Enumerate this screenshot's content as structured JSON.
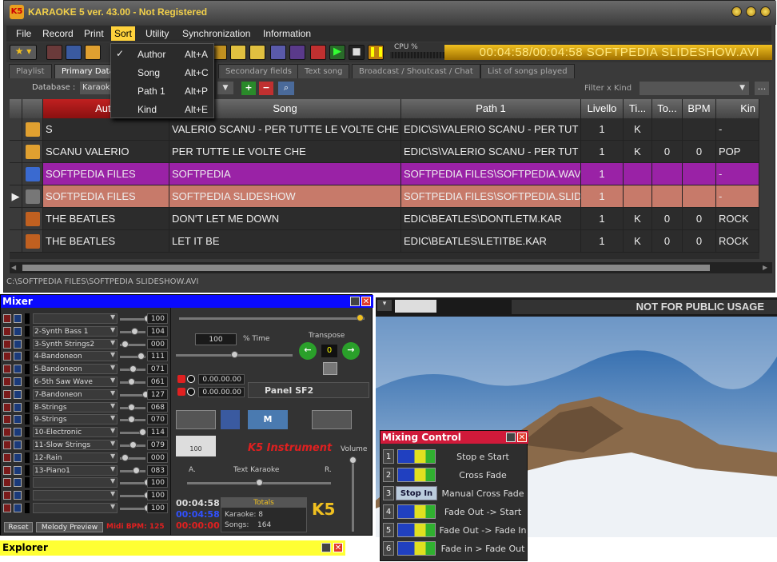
{
  "app": {
    "title": "KARAOKE 5   ver. 43.00 - Not Registered"
  },
  "menubar": {
    "items": [
      {
        "label": "File"
      },
      {
        "label": "Record"
      },
      {
        "label": "Print"
      },
      {
        "label": "Sort"
      },
      {
        "label": "Utility"
      },
      {
        "label": "Synchronization"
      },
      {
        "label": "Information"
      }
    ]
  },
  "sort_menu": {
    "items": [
      {
        "label": "Author",
        "shortcut": "Alt+A",
        "checked": true
      },
      {
        "label": "Song",
        "shortcut": "Alt+C"
      },
      {
        "label": "Path 1",
        "shortcut": "Alt+P"
      },
      {
        "label": "Kind",
        "shortcut": "Alt+E"
      }
    ]
  },
  "toolbar": {
    "cpu_label": "CPU %",
    "now_playing": "00:04:58/00:04:58  SOFTPEDIA SLIDESHOW.AVI"
  },
  "tabs": [
    {
      "label": "Playlist"
    },
    {
      "label": "Primary Data"
    },
    {
      "label": "Secondary fields"
    },
    {
      "label": "Text song"
    },
    {
      "label": "Broadcast / Shoutcast / Chat"
    },
    {
      "label": "List of songs played"
    }
  ],
  "database": {
    "label": "Database :",
    "value": "Karaok",
    "filter_label": "Filter x Kind"
  },
  "grid": {
    "columns": [
      {
        "label": ""
      },
      {
        "label": "Auth"
      },
      {
        "label": "Song"
      },
      {
        "label": "Path 1"
      },
      {
        "label": "Livello"
      },
      {
        "label": "Ti..."
      },
      {
        "label": "To..."
      },
      {
        "label": "BPM"
      },
      {
        "label": "Kin"
      }
    ],
    "rows": [
      {
        "author": "S",
        "song": "VALERIO SCANU - PER TUTTE LE VOLTE CHE",
        "path": "EDIC\\S\\VALERIO SCANU - PER TUT",
        "livello": "1",
        "ti": "K",
        "to": "",
        "bpm": "",
        "kind": "-",
        "icon": "karaoke-icon",
        "style": "normal"
      },
      {
        "author": "SCANU VALERIO",
        "song": "PER TUTTE LE VOLTE CHE",
        "path": "EDIC\\S\\VALERIO SCANU - PER TUT",
        "livello": "1",
        "ti": "K",
        "to": "0",
        "bpm": "0",
        "kind": "POP",
        "icon": "karaoke-icon",
        "style": "normal"
      },
      {
        "author": "SOFTPEDIA FILES",
        "song": "SOFTPEDIA",
        "path": "SOFTPEDIA FILES\\SOFTPEDIA.WAV",
        "livello": "1",
        "ti": "",
        "to": "",
        "bpm": "",
        "kind": "-",
        "icon": "music-note-icon",
        "style": "purple"
      },
      {
        "author": "SOFTPEDIA FILES",
        "song": "SOFTPEDIA SLIDESHOW",
        "path": "SOFTPEDIA FILES\\SOFTPEDIA.SLIDE",
        "livello": "1",
        "ti": "",
        "to": "",
        "bpm": "",
        "kind": "-",
        "icon": "film-reel-icon",
        "style": "salmon"
      },
      {
        "author": "THE BEATLES",
        "song": "DON'T LET ME DOWN",
        "path": "EDIC\\BEATLES\\DONTLETM.KAR",
        "livello": "1",
        "ti": "K",
        "to": "0",
        "bpm": "0",
        "kind": "ROCK",
        "icon": "kar-file-icon",
        "style": "normal"
      },
      {
        "author": "THE BEATLES",
        "song": "LET IT BE",
        "path": "EDIC\\BEATLES\\LETITBE.KAR",
        "livello": "1",
        "ti": "K",
        "to": "0",
        "bpm": "0",
        "kind": "ROCK",
        "icon": "kar-file-icon",
        "style": "normal"
      }
    ]
  },
  "status": {
    "path": "C:\\SOFTPEDIA FILES\\SOFTPEDIA SLIDESHOW.AVI"
  },
  "mixer": {
    "title": "Mixer",
    "channels": [
      {
        "name": "",
        "value": "100"
      },
      {
        "name": "2-Synth Bass 1",
        "value": "104"
      },
      {
        "name": "3-Synth Strings2",
        "value": "000"
      },
      {
        "name": "4-Bandoneon",
        "value": "111"
      },
      {
        "name": "5-Bandoneon",
        "value": "071"
      },
      {
        "name": "6-5th Saw Wave",
        "value": "061"
      },
      {
        "name": "7-Bandoneon",
        "value": "127"
      },
      {
        "name": "8-Strings",
        "value": "068"
      },
      {
        "name": "9-Strings",
        "value": "070"
      },
      {
        "name": "10-Electronic",
        "value": "114"
      },
      {
        "name": "11-Slow Strings",
        "value": "079"
      },
      {
        "name": "12-Rain",
        "value": "000"
      },
      {
        "name": "13-Piano1",
        "value": "083"
      },
      {
        "name": "",
        "value": "100"
      },
      {
        "name": "",
        "value": "100"
      },
      {
        "name": "",
        "value": "100"
      }
    ],
    "reset_label": "Reset",
    "preview_label": "Melody Preview",
    "midi_bpm": "Midi BPM: 125",
    "tempo_value": "100",
    "time_label": "% Time",
    "transpose_label": "Transpose",
    "transpose_value": "0",
    "time1": "0.00.00.00",
    "time2": "0.00.00.00",
    "panel_label": "Panel SF2",
    "instrument_label": "K5 Instrument",
    "volume_label": "Volume",
    "text_karaoke_label": "Text Karaoke",
    "a_label": "A.",
    "r_label": "R.",
    "dial_value": "100",
    "clock1": "00:04:58",
    "clock2": "00:04:58",
    "clock3": "00:00:00",
    "totals_label": "Totals",
    "karaoke_count": "Karaoke: 8",
    "songs_label": "Songs:",
    "songs_count": "164"
  },
  "video": {
    "banner": "NOT FOR PUBLIC USAGE"
  },
  "mixing_control": {
    "title": "Mixing Control",
    "items": [
      {
        "num": "1",
        "label": "Stop e Start"
      },
      {
        "num": "2",
        "label": "Cross Fade"
      },
      {
        "num": "3",
        "label": "Manual Cross Fade",
        "button": "Stop In"
      },
      {
        "num": "4",
        "label": "Fade Out -> Start"
      },
      {
        "num": "5",
        "label": "Fade Out -> Fade In"
      },
      {
        "num": "6",
        "label": "Fade in > Fade Out"
      }
    ]
  },
  "explorer": {
    "title": "Explorer"
  },
  "colors": {
    "accent": "#ffd23c",
    "purple_row": "#9a22a6",
    "salmon_row": "#c77a6a",
    "mixer_title": "#0a0aff",
    "mixing_title": "#d01a3a",
    "explorer_title": "#ffff33"
  }
}
